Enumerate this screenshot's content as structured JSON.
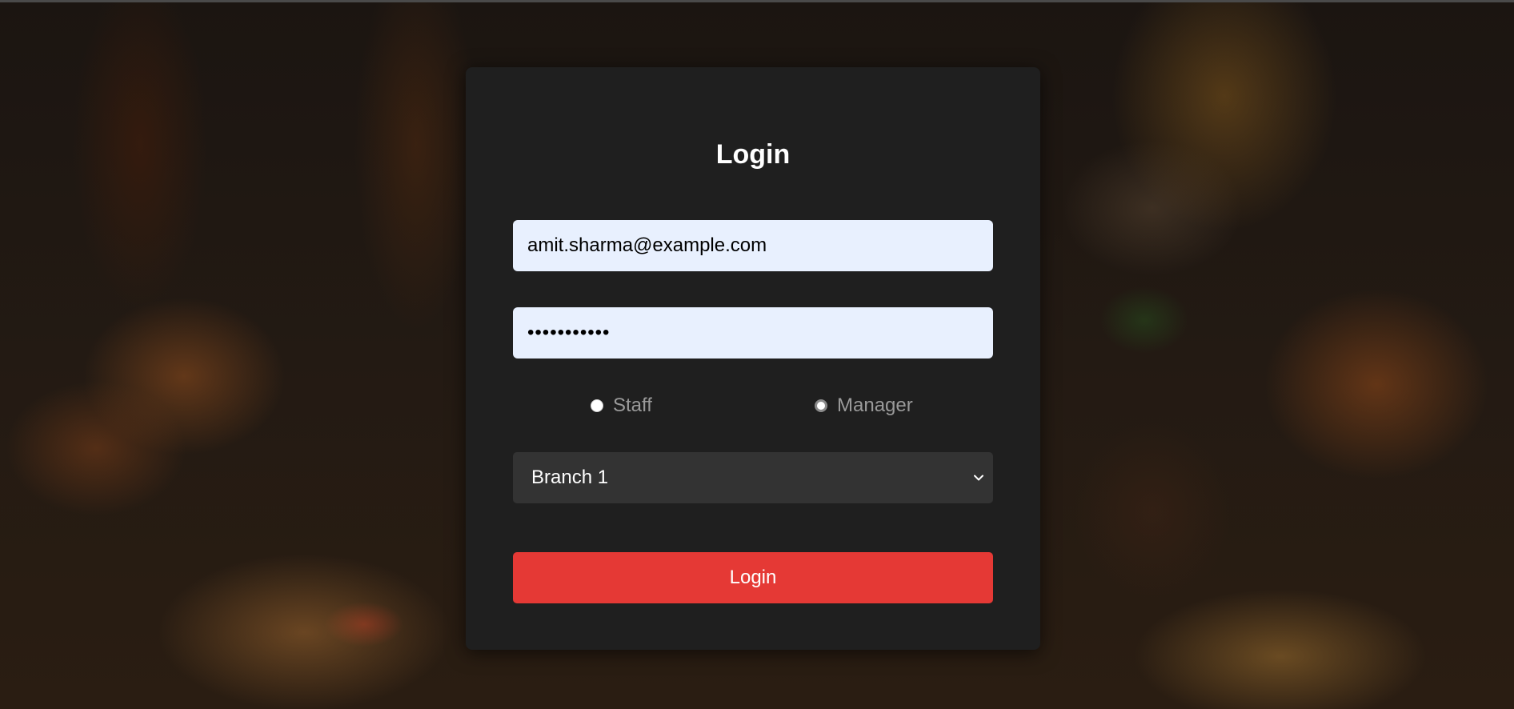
{
  "login_form": {
    "title": "Login",
    "email_value": "amit.sharma@example.com",
    "password_value": "•••••••••••",
    "roles": [
      {
        "label": "Staff",
        "selected": false
      },
      {
        "label": "Manager",
        "selected": true
      }
    ],
    "branch_selected": "Branch 1",
    "submit_label": "Login"
  },
  "colors": {
    "card_background": "#1f1f1f",
    "input_background": "#e8f0fe",
    "select_background": "#333333",
    "accent_button": "#e53935"
  },
  "icons": {
    "select_arrow": "chevron-down-icon"
  }
}
